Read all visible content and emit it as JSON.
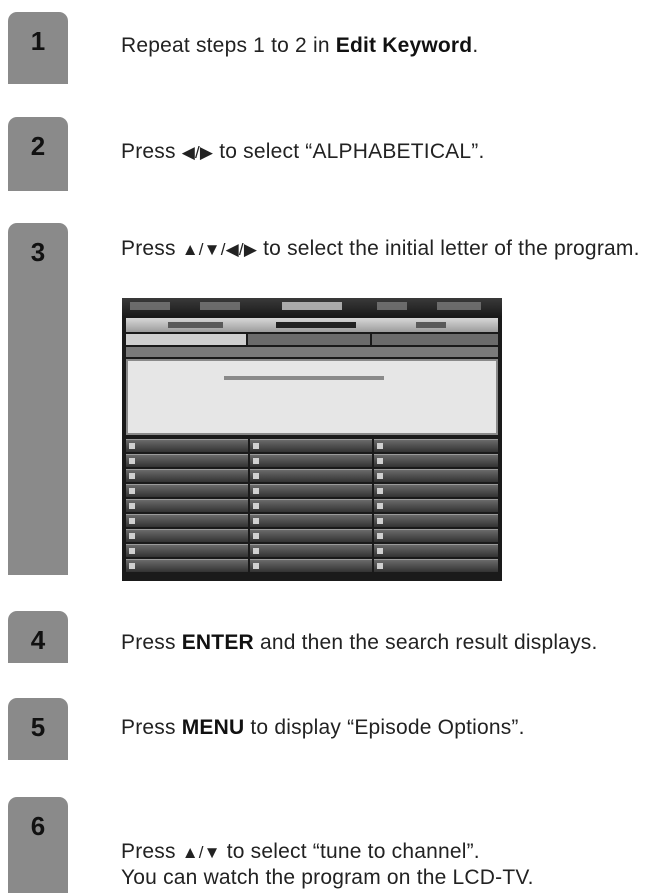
{
  "steps": [
    {
      "number": "1",
      "parts": [
        "Repeat steps 1 to 2 in ",
        "Edit Keyword",
        "."
      ]
    },
    {
      "number": "2",
      "parts": [
        "Press ",
        "◀/▶",
        " to select “ALPHABETICAL”."
      ]
    },
    {
      "number": "3",
      "parts": [
        "Press ",
        "▲/▼/◀/▶",
        " to select the initial letter of the program."
      ]
    },
    {
      "number": "4",
      "parts": [
        "Press ",
        "ENTER",
        " and then the search result displays."
      ]
    },
    {
      "number": "5",
      "parts": [
        "Press ",
        "MENU",
        " to display “Episode Options”."
      ]
    },
    {
      "number": "6",
      "parts": [
        "Press ",
        "▲/▼",
        " to select “tune to channel”.",
        "You can watch the program on the LCD-TV."
      ]
    }
  ],
  "colors": {
    "tab": "#8a8a8a",
    "screen_bg": "#1a1a1a",
    "panel": "#e6e6e6"
  }
}
